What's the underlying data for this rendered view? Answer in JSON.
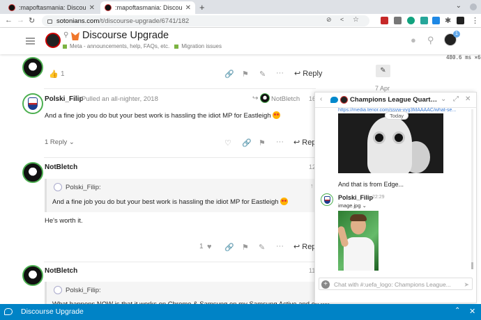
{
  "browser": {
    "tabs": [
      {
        "title": ":mapoftasmania: Discourse Upgr",
        "active": false
      },
      {
        "title": ":mapoftasmania: Discourse Upgr",
        "active": true
      }
    ],
    "url_host": "sotonians.com",
    "url_path": "/t/discourse-upgrade/6741/182"
  },
  "header": {
    "title": "Discourse Upgrade",
    "category": "Meta - announcements, help, FAQs, etc.",
    "tag": "Migration issues",
    "notification_count": "1",
    "perf": "480.6 ms ×6"
  },
  "timeline": {
    "date": "7 Apr"
  },
  "posts": [
    {
      "likes": "1",
      "reply_label": "Reply"
    },
    {
      "username": "Polski_Filip",
      "user_title": "Pulled an all-nighter, 2018",
      "reply_to": "NotBletch",
      "timestamp": "16",
      "text": "And a fine job you do but your best work is hassling the idiot MP for Eastleigh",
      "replies": "1 Reply",
      "reply_label": "Rep"
    },
    {
      "username": "NotBletch",
      "timestamp": "12",
      "quote_user": "Polski_Filip:",
      "quote_text": "And a fine job you do but your best work is hassling the idiot MP for Eastleigh",
      "text": "He's worth it.",
      "likes": "1",
      "reply_label": "Rep"
    },
    {
      "username": "NotBletch",
      "timestamp": "11",
      "quote_user": "Polski_Filip:",
      "quote_text": "What happens NOW is that it works on Chrome & Samsung on my Samsung Active and on my"
    }
  ],
  "chat": {
    "title": "Champions League Quarter...",
    "link": "https://media.tenor.com/ssvw-yyg3MAAAAC/what-se...",
    "today_label": "Today",
    "message1": "And that is from Edge...",
    "user": "Polski_Filip",
    "time": "22:29",
    "file": "image.jpg",
    "input_placeholder": "Chat with #:uefa_logo: Champions League..."
  },
  "bottombar": {
    "title": "Discourse Upgrade"
  },
  "colors": {
    "accent": "#0083c6",
    "category": "#7cb342",
    "avatar_ring": "#4caf50"
  }
}
